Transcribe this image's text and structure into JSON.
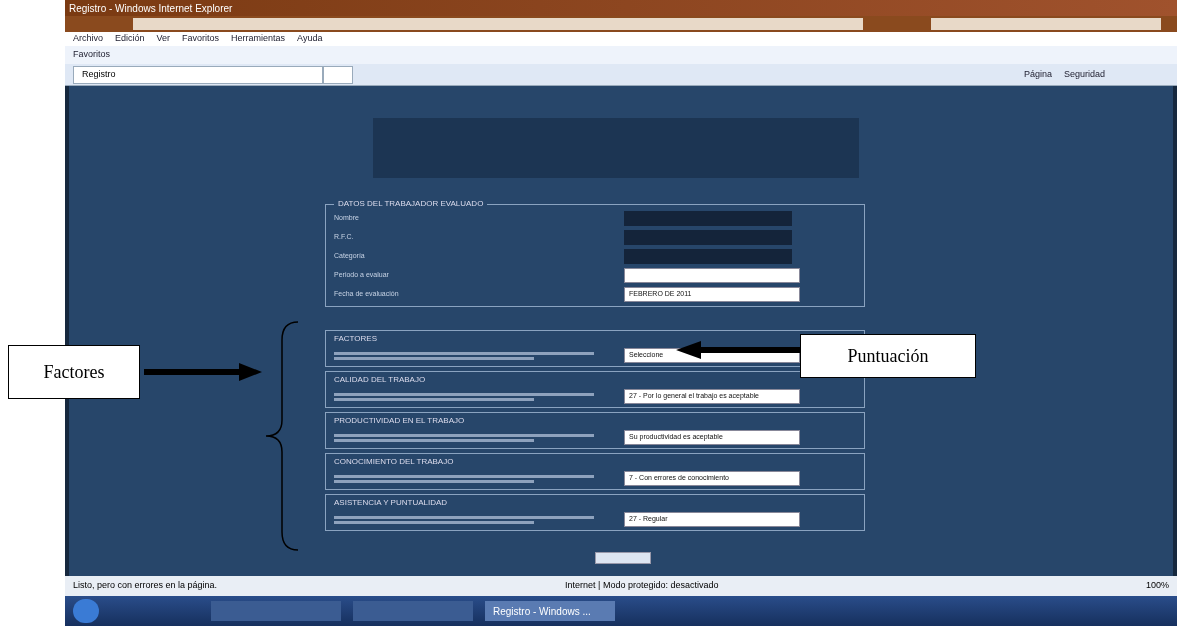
{
  "window": {
    "title": "Registro - Windows Internet Explorer"
  },
  "menu": [
    "Archivo",
    "Edición",
    "Ver",
    "Favoritos",
    "Herramientas",
    "Ayuda"
  ],
  "favorites": {
    "label": "Favoritos"
  },
  "tab": {
    "label": "Registro",
    "selected": true
  },
  "command_bar": [
    "Página",
    "Seguridad"
  ],
  "personal_section": {
    "legend": "DATOS DEL TRABAJADOR EVALUADO",
    "rows": [
      {
        "label": "Nombre",
        "kind": "readonly"
      },
      {
        "label": "R.F.C.",
        "kind": "readonly"
      },
      {
        "label": "Categoría",
        "kind": "readonly"
      },
      {
        "label": "Periodo a evaluar",
        "kind": "select"
      },
      {
        "label": "Fecha de evaluación",
        "kind": "select",
        "value": "FEBRERO DE 2011"
      }
    ]
  },
  "factors": [
    {
      "title": "FACTORES",
      "value": "Seleccione"
    },
    {
      "title": "CALIDAD DEL TRABAJO",
      "value": "27 - Por lo general el trabajo es aceptable"
    },
    {
      "title": "PRODUCTIVIDAD EN EL TRABAJO",
      "value": "Su productividad es aceptable"
    },
    {
      "title": "CONOCIMIENTO DEL TRABAJO",
      "value": "7 - Con errores de conocimiento"
    },
    {
      "title": "ASISTENCIA Y PUNTUALIDAD",
      "value": "27 - Regular"
    }
  ],
  "status_bar": {
    "message": "Listo, pero con errores en la página.",
    "zone": "Internet | Modo protegido: desactivado",
    "zoom": "100%"
  },
  "taskbar": {
    "window": "Registro - Windows ..."
  },
  "annotations": {
    "factors_label": "Factores",
    "score_label": "Puntuación"
  }
}
